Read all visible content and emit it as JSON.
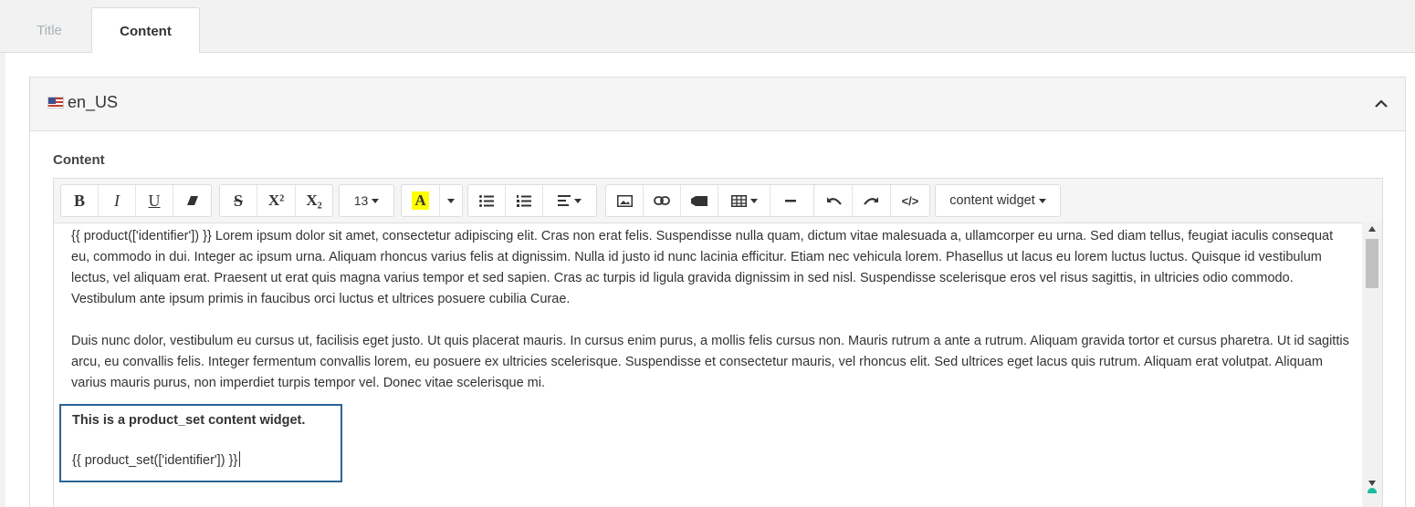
{
  "tabs": [
    {
      "label": "Title",
      "active": false
    },
    {
      "label": "Content",
      "active": true
    }
  ],
  "panel": {
    "locale": "en_US",
    "field_label": "Content"
  },
  "toolbar": {
    "bold": "B",
    "italic": "I",
    "underline": "U",
    "strikethrough": "S",
    "superscript": "X²",
    "subscript": "X₂",
    "font_size": "13",
    "highlight": "A",
    "code_view": "</>",
    "content_widget": "content widget"
  },
  "editor": {
    "paragraph1": "{{ product(['identifier']) }} Lorem ipsum dolor sit amet, consectetur adipiscing elit. Cras non erat felis. Suspendisse nulla quam, dictum vitae malesuada a, ullamcorper eu urna. Sed diam tellus, feugiat iaculis consequat eu, commodo in dui. Integer ac ipsum urna. Aliquam rhoncus varius felis at dignissim. Nulla id justo id nunc lacinia efficitur. Etiam nec vehicula lorem. Phasellus ut lacus eu lorem luctus luctus. Quisque id vestibulum lectus, vel aliquam erat. Praesent ut erat quis magna varius tempor et sed sapien. Cras ac turpis id ligula gravida dignissim in sed nisl. Suspendisse scelerisque eros vel risus sagittis, in ultricies odio commodo. Vestibulum ante ipsum primis in faucibus orci luctus et ultrices posuere cubilia Curae.",
    "paragraph2": "Duis nunc dolor, vestibulum eu cursus ut, facilisis eget justo. Ut quis placerat mauris. In cursus enim purus, a mollis felis cursus non. Mauris rutrum a ante a rutrum. Aliquam gravida tortor et cursus pharetra. Ut id sagittis arcu, eu convallis felis. Integer fermentum convallis lorem, eu posuere ex ultricies scelerisque. Suspendisse et consectetur mauris, vel rhoncus elit. Sed ultrices eget lacus quis rutrum. Aliquam erat volutpat. Aliquam varius mauris purus, non imperdiet turpis tempor vel. Donec vitae scelerisque mi.",
    "widget_title": "This is a product_set content widget.",
    "widget_code": "{{ product_set(['identifier']) }}"
  },
  "colors": {
    "highlight_yellow": "#ffff00",
    "widget_border": "#2a6496"
  }
}
